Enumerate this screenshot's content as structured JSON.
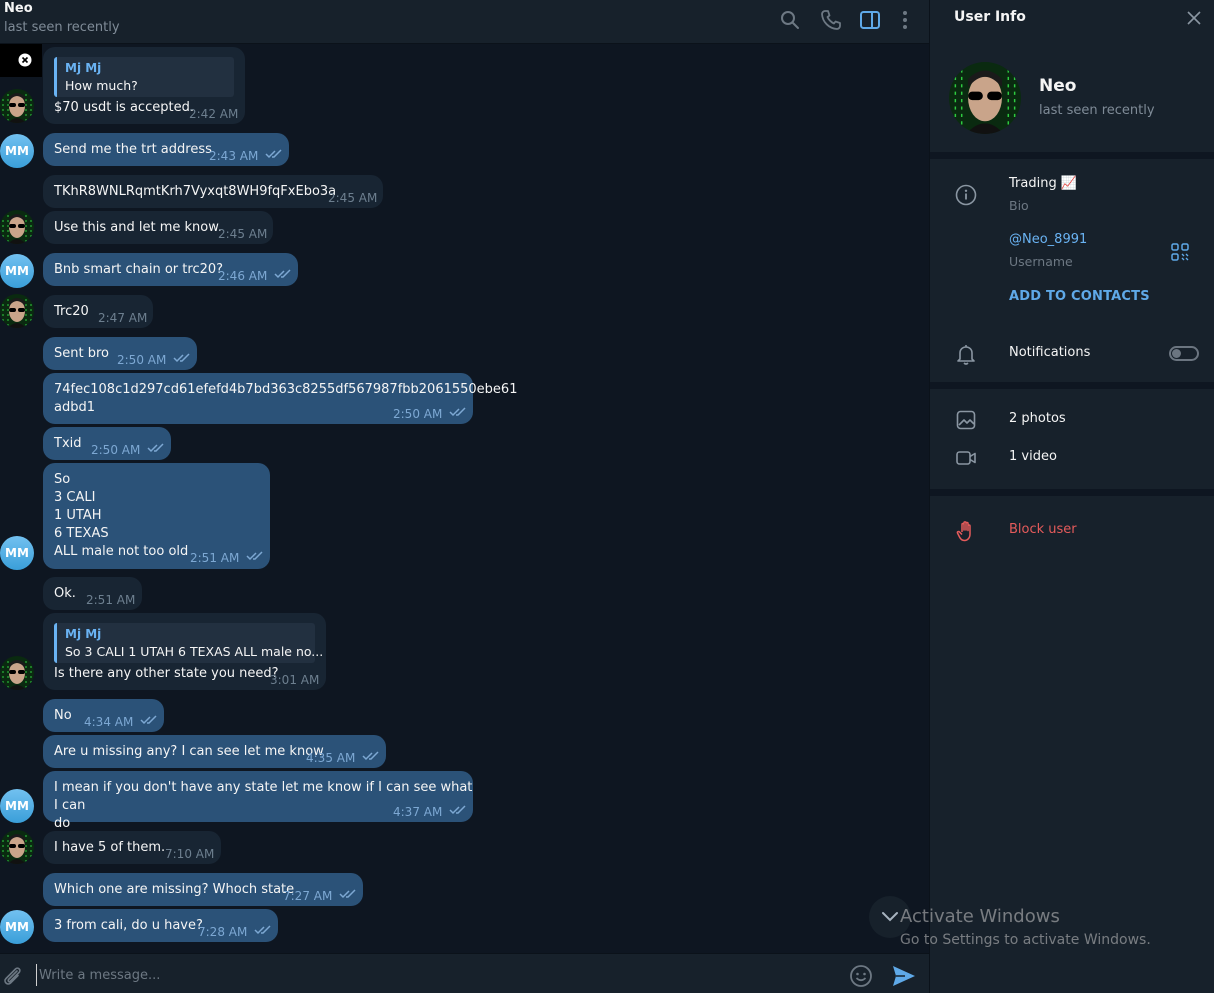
{
  "header": {
    "name": "Neo",
    "status": "last seen recently",
    "icons": [
      "search-icon",
      "phone-icon",
      "sidebar-toggle-icon",
      "more-vertical-icon"
    ]
  },
  "contact": {
    "avatar_initials": "MM",
    "quoted_name": "Mj Mj"
  },
  "messages": [
    {
      "id": "m1",
      "dir": "in",
      "reply_name": "Mj Mj",
      "reply_text": "How much?",
      "text": "$70 usdt is accepted.",
      "time": "2:42 AM"
    },
    {
      "id": "m2",
      "dir": "out",
      "text": "Send me the trt address",
      "time": "2:43 AM"
    },
    {
      "id": "m3",
      "dir": "in",
      "text": "TKhR8WNLRqmtKrh7Vyxqt8WH9fqFxEbo3a",
      "time": "2:45 AM"
    },
    {
      "id": "m4",
      "dir": "in",
      "text": "Use this and let me know.",
      "time": "2:45 AM"
    },
    {
      "id": "m5",
      "dir": "out",
      "text": "Bnb smart chain or trc20?",
      "time": "2:46 AM"
    },
    {
      "id": "m6",
      "dir": "in",
      "text": "Trc20",
      "time": "2:47 AM"
    },
    {
      "id": "m7",
      "dir": "out",
      "text": "Sent bro",
      "time": "2:50 AM"
    },
    {
      "id": "m8",
      "dir": "out",
      "text": "74fec108c1d297cd61efefd4b7bd363c8255df567987fbb2061550ebe61\nadbd1",
      "time": "2:50 AM"
    },
    {
      "id": "m9",
      "dir": "out",
      "text": "Txid",
      "time": "2:50 AM"
    },
    {
      "id": "m10",
      "dir": "out",
      "text": "So\n3 CALI\n1 UTAH\n6 TEXAS\nALL male not too old",
      "time": "2:51 AM"
    },
    {
      "id": "m11",
      "dir": "in",
      "text": "Ok.",
      "time": "2:51 AM"
    },
    {
      "id": "m12",
      "dir": "in",
      "reply_name": "Mj Mj",
      "reply_text": "So  3 CALI 1 UTAH 6 TEXAS  ALL male no...",
      "text": "Is there any other state you need?",
      "time": "3:01 AM"
    },
    {
      "id": "m13",
      "dir": "out",
      "text": "No",
      "time": "4:34 AM"
    },
    {
      "id": "m14",
      "dir": "out",
      "text": "Are u missing any? I can see let me know",
      "time": "4:35 AM"
    },
    {
      "id": "m15",
      "dir": "out",
      "text": "I mean if you don't have any state let me know if I can see what I can\ndo",
      "time": "4:37 AM"
    },
    {
      "id": "m16",
      "dir": "in",
      "text": "I have 5 of them.",
      "time": "7:10 AM"
    },
    {
      "id": "m17",
      "dir": "out",
      "text": "Which one are missing? Whoch state",
      "time": "7:27 AM"
    },
    {
      "id": "m18",
      "dir": "out",
      "text": "3 from cali, do u have?",
      "time": "7:28 AM"
    }
  ],
  "input": {
    "placeholder": "Write a message..."
  },
  "info": {
    "title": "User Info",
    "name": "Neo",
    "status": "last seen recently",
    "bio": "Trading 📈",
    "bio_label": "Bio",
    "username": "@Neo_8991",
    "username_label": "Username",
    "add_contacts": "ADD TO CONTACTS",
    "notifications": "Notifications",
    "notifications_on": false,
    "photos": "2 photos",
    "videos": "1 video",
    "block": "Block user"
  },
  "watermark": {
    "title": "Activate Windows",
    "subtitle": "Go to Settings to activate Windows."
  },
  "colors": {
    "background": "#0e1621",
    "panel": "#17212b",
    "incoming_bubble": "#182533",
    "outgoing_bubble": "#2b5278",
    "accent": "#6ab3f3",
    "danger": "#e55b5b"
  }
}
